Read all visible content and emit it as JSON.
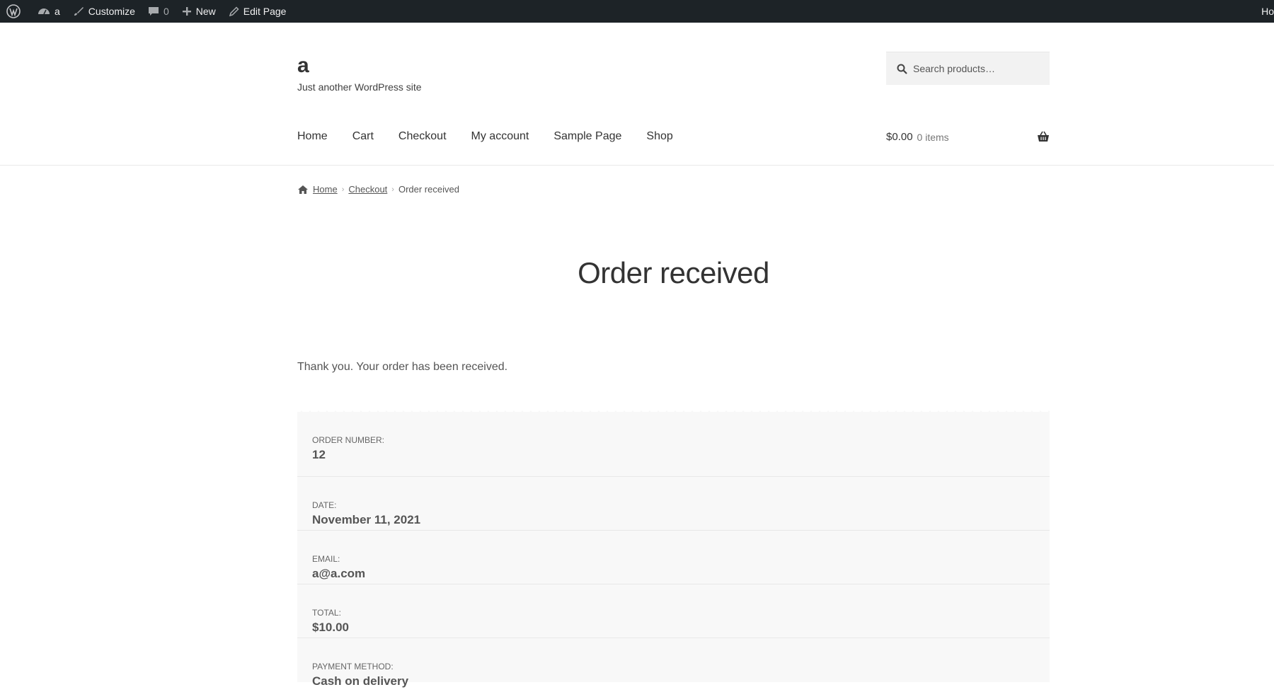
{
  "adminbar": {
    "site_name": "a",
    "customize": "Customize",
    "comments_count": "0",
    "new_label": "New",
    "edit_page": "Edit Page",
    "right_text": "Ho"
  },
  "site": {
    "title": "a",
    "description": "Just another WordPress site"
  },
  "search": {
    "placeholder": "Search products…"
  },
  "nav": {
    "items": [
      "Home",
      "Cart",
      "Checkout",
      "My account",
      "Sample Page",
      "Shop"
    ]
  },
  "cart": {
    "amount": "$0.00",
    "items": "0 items"
  },
  "breadcrumb": {
    "home": "Home",
    "checkout": "Checkout",
    "current": "Order received"
  },
  "page": {
    "title": "Order received",
    "thanks": "Thank you. Your order has been received."
  },
  "order": {
    "rows": [
      {
        "label": "ORDER NUMBER:",
        "value": "12"
      },
      {
        "label": "DATE:",
        "value": "November 11, 2021"
      },
      {
        "label": "EMAIL:",
        "value": "a@a.com"
      },
      {
        "label": "TOTAL:",
        "value": "$10.00"
      },
      {
        "label": "PAYMENT METHOD:",
        "value": "Cash on delivery"
      }
    ]
  }
}
